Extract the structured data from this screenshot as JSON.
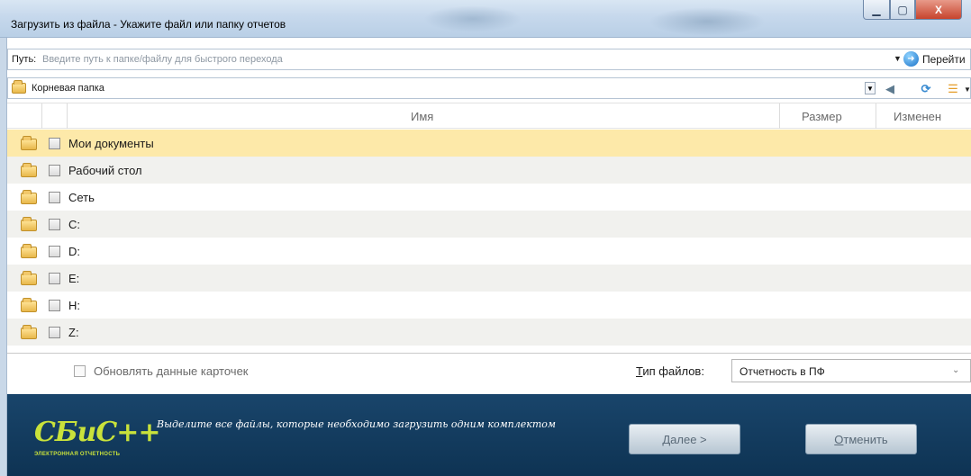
{
  "window": {
    "title": "Загрузить из файла - Укажите файл или папку отчетов",
    "minimize_glyph": "▁",
    "maximize_glyph": "▢",
    "close_glyph": "X"
  },
  "path": {
    "label": "Путь:",
    "placeholder": "Введите путь к папке/файлу для быстрого перехода",
    "dropdown_glyph": "▼",
    "go_label": "Перейти"
  },
  "folder_bar": {
    "current": "Корневая папка",
    "dropdown_glyph": "▼",
    "view_dropdown_glyph": "▼"
  },
  "table": {
    "columns": {
      "name": "Имя",
      "size": "Размер",
      "modified": "Изменен"
    },
    "rows": [
      {
        "label": "Мои документы",
        "selected": true
      },
      {
        "label": "Рабочий стол"
      },
      {
        "label": "Сеть"
      },
      {
        "label": "C:"
      },
      {
        "label": "D:"
      },
      {
        "label": "E:"
      },
      {
        "label": "H:"
      },
      {
        "label": "Z:"
      }
    ]
  },
  "options": {
    "update_cards_label": "Обновлять данные карточек",
    "file_type_label_hotkey": "Т",
    "file_type_label_rest": "ип файлов:",
    "file_type_value": "Отчетность в ПФ"
  },
  "banner": {
    "logo": "СБиС++",
    "logo_sub": "ЭЛЕКТРОННАЯ ОТЧЕТНОСТЬ",
    "hint": "Выделите все файлы, которые необходимо загрузить одним комплектом",
    "next_hotkey": "Д",
    "next_rest": "алее >",
    "cancel_hotkey": "О",
    "cancel_rest": "тменить"
  },
  "colors": {
    "selected_row": "#fde9a9",
    "alt_row": "#f1f1ee",
    "banner": "#0e3353",
    "logo": "#c9e23b"
  }
}
